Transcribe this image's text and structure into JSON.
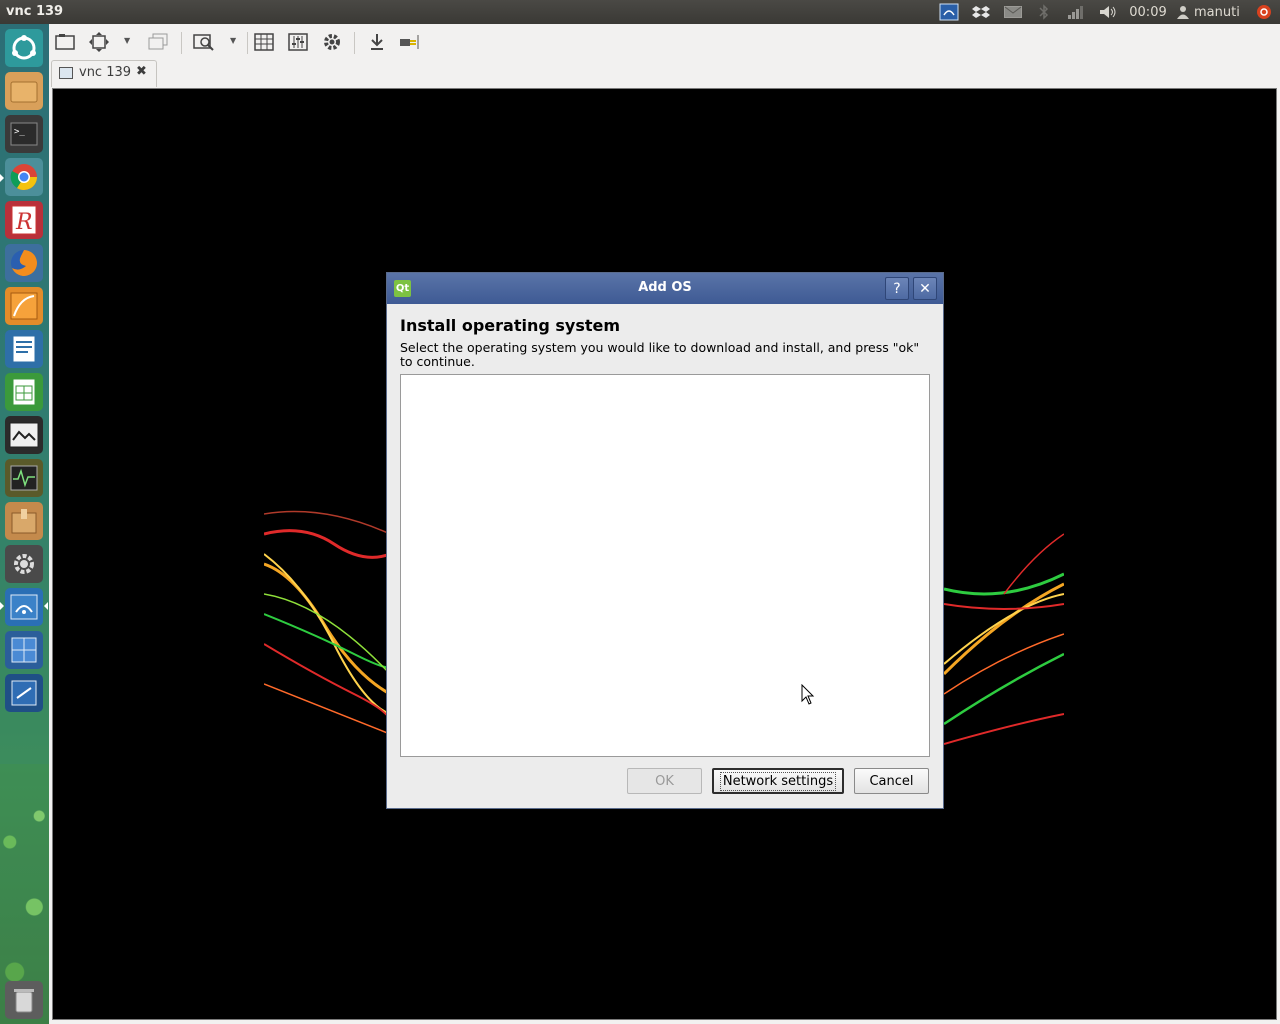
{
  "top_panel": {
    "app_title": "vnc 139",
    "clock": "00:09",
    "user": "manuti",
    "indicators": [
      "remote-desktop-icon",
      "dropbox-icon",
      "mail-icon",
      "bluetooth-icon",
      "network-signal-icon",
      "volume-icon",
      "user-icon",
      "power-icon"
    ]
  },
  "launcher": {
    "items": [
      "dash-home-icon",
      "files-icon",
      "terminal-icon",
      "chrome-icon",
      "rstudio-icon",
      "firefox-icon",
      "sketch-icon",
      "writer-icon",
      "calc-icon",
      "video-editor-icon",
      "system-monitor-icon",
      "package-icon",
      "settings-icon",
      "remmina-icon",
      "window-manager-icon",
      "screenshot-icon",
      "trash-icon"
    ]
  },
  "toolbar": {
    "buttons": [
      "screen-icon",
      "fit-window-icon",
      "window-icon",
      "zoom-icon",
      "grid-icon",
      "preferences-icon",
      "settings-icon",
      "download-icon",
      "disconnect-icon"
    ]
  },
  "tab": {
    "label": "vnc 139",
    "close": "✖"
  },
  "dialog": {
    "title": "Add OS",
    "help": "?",
    "close": "✕",
    "heading": "Install operating system",
    "description": "Select the operating system you would like to download and install, and press \"ok\" to continue.",
    "ok_label": "OK",
    "network_label": "Network settings",
    "cancel_label": "Cancel"
  },
  "colors": {
    "titlebar": "#4a66a0",
    "launcher": "#2f7a72",
    "panel": "#3c3b37"
  }
}
